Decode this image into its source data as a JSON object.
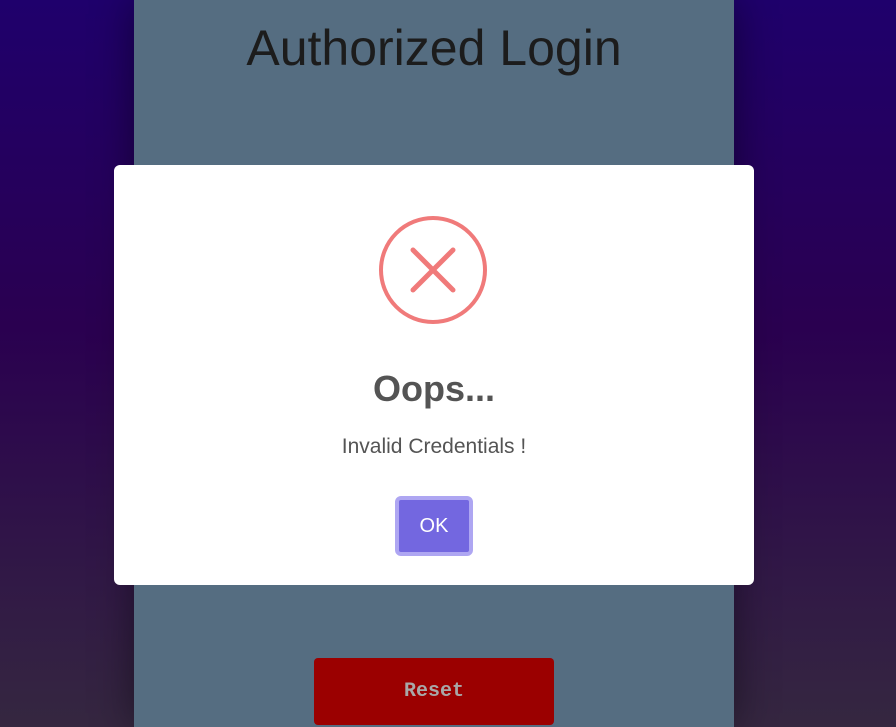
{
  "login": {
    "title": "Authorized Login",
    "reset_label": "Reset"
  },
  "dialog": {
    "icon": "error-x-icon",
    "title": "Oops...",
    "message": "Invalid Credentials !",
    "ok_label": "OK"
  },
  "colors": {
    "panel_bg": "#556d81",
    "reset_bg": "#9b0000",
    "ok_bg": "#7367e0",
    "error_icon": "#f07a7a"
  }
}
